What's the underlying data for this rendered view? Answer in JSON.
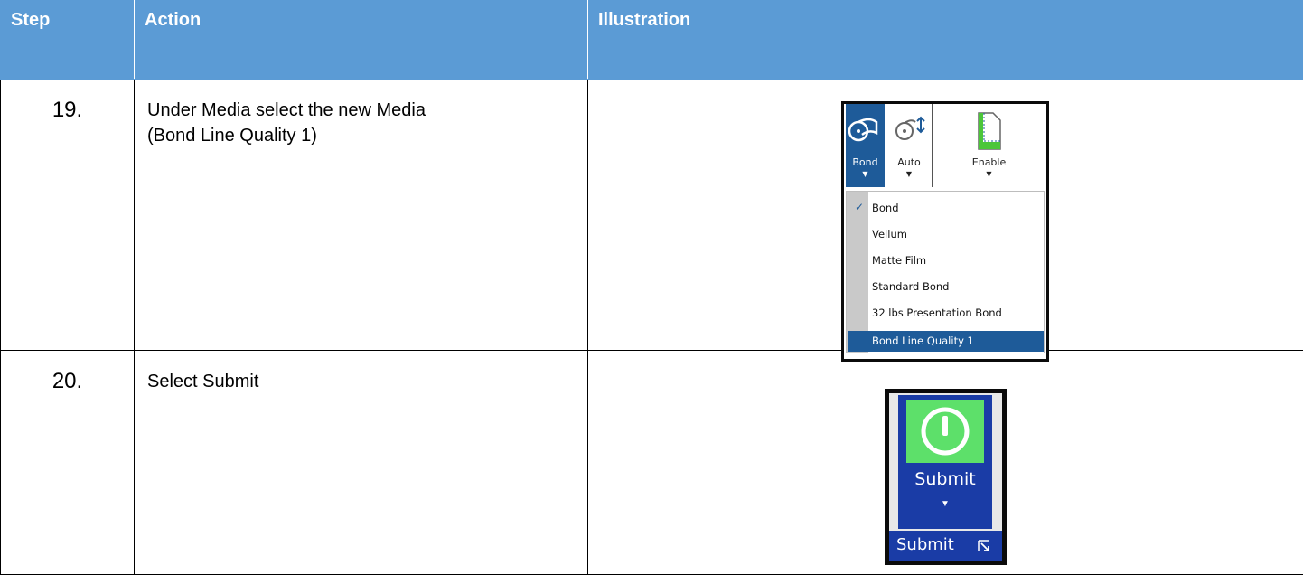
{
  "table": {
    "headers": [
      "Step",
      "Action",
      "Illustration"
    ],
    "rows": [
      {
        "step": "19.",
        "action_line1": "Under Media select the new Media",
        "action_line2": "(Bond Line Quality 1)"
      },
      {
        "step": "20.",
        "action_line1": "Select Submit"
      }
    ]
  },
  "media_ribbon": {
    "buttons": [
      {
        "label": "Bond",
        "icon": "media-roll-icon"
      },
      {
        "label": "Auto",
        "icon": "auto-roll-icon"
      },
      {
        "label": "Enable",
        "icon": "page-trim-icon"
      }
    ],
    "dropdown": {
      "checked_item": "Bond",
      "items": [
        "Bond",
        "Vellum",
        "Matte Film",
        "Standard Bond",
        "32 lbs Presentation Bond",
        "Bond Line Quality 1"
      ],
      "highlighted_item": "Bond Line Quality 1"
    }
  },
  "submit_panel": {
    "button_label": "Submit",
    "group_label": "Submit",
    "icon": "power-icon"
  },
  "colors": {
    "header_blue": "#5b9bd5",
    "ribbon_blue": "#1e5b99",
    "submit_blue": "#1a3ca6",
    "submit_green": "#5de06a"
  }
}
